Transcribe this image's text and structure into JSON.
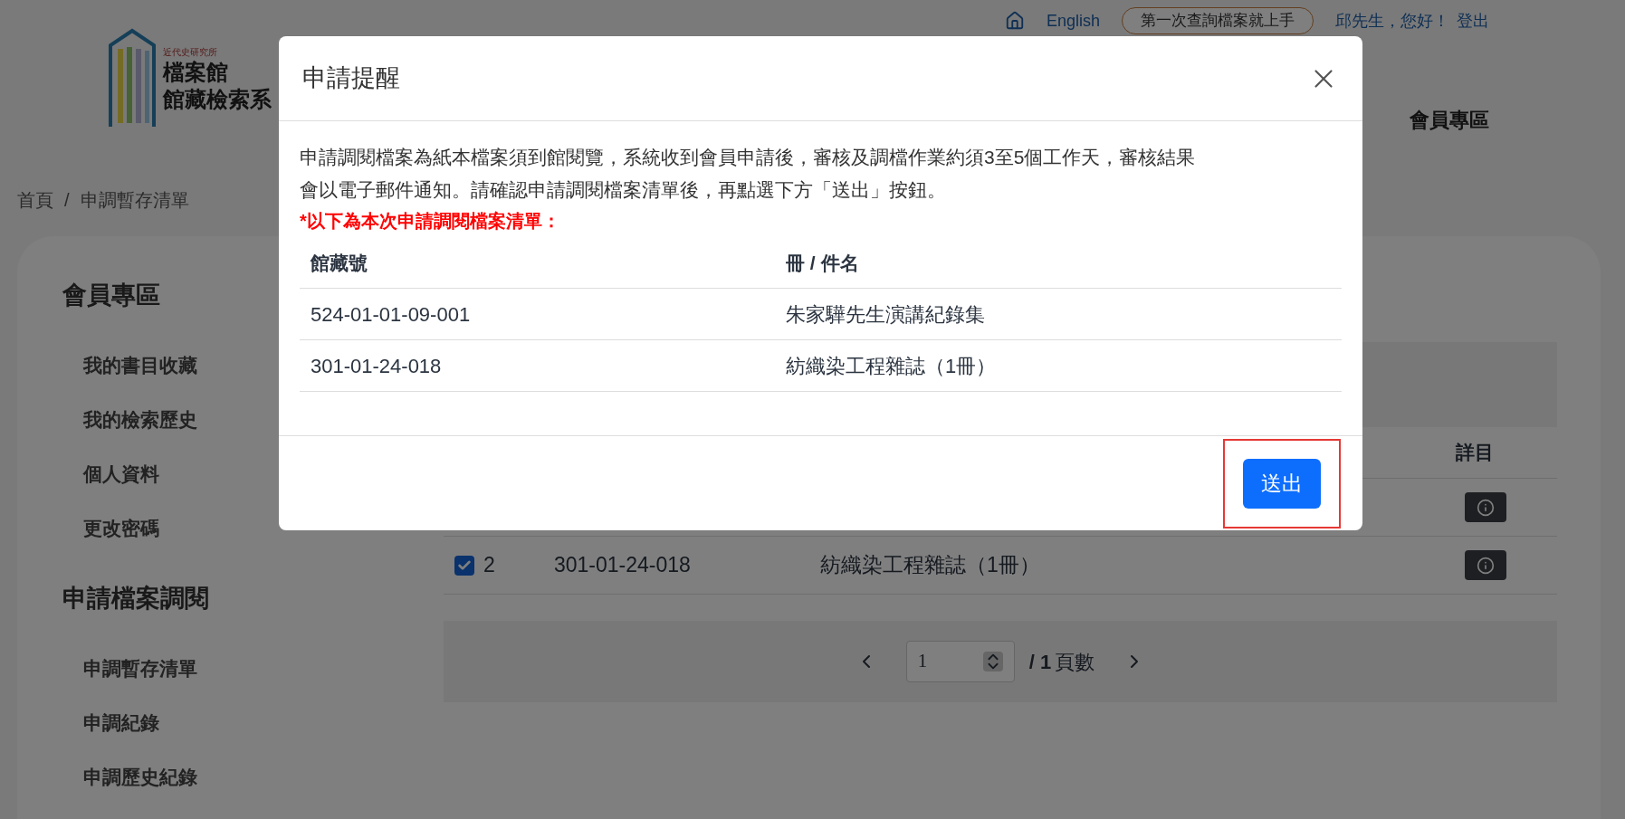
{
  "header": {
    "logo_org": "近代史研究所",
    "logo_line1": "檔案館",
    "logo_line2": "館藏檢索系",
    "language": "English",
    "guide_button": "第一次查詢檔案就上手",
    "greeting": "邱先生，您好！",
    "logout": "登出",
    "nav": [
      "會員專區"
    ]
  },
  "breadcrumb": {
    "items": [
      "首頁",
      "申調暫存清單"
    ],
    "separator": "/"
  },
  "sidebar": [
    {
      "title": "會員專區",
      "items": [
        "我的書目收藏",
        "我的檢索歷史",
        "個人資料",
        "更改密碼"
      ]
    },
    {
      "title": "申請檔案調閱",
      "items": [
        "申調暫存清單",
        "申調紀錄",
        "申調歷史紀錄"
      ]
    }
  ],
  "list": {
    "columns": [
      "詳目"
    ],
    "rows": [
      {
        "kind": "covered"
      },
      {
        "kind": "row",
        "checked": true,
        "index": "2",
        "number": "301-01-24-018",
        "title": "紡織染工程雜誌（1冊）"
      }
    ]
  },
  "pagination": {
    "page": "1",
    "total": "/ 1",
    "unit": "頁數"
  },
  "modal": {
    "title": "申請提醒",
    "message": "申請調閱檔案為紙本檔案須到館閱覽，系統收到會員申請後，審核及調檔作業約須3至5個工作天，審核結果會以電子郵件通知。請確認申請調閱檔案清單後，再點選下方「送出」按鈕。",
    "notice": "*以下為本次申請調閱檔案清單：",
    "columns": [
      "館藏號",
      "冊 / 件名"
    ],
    "rows": [
      [
        "524-01-01-09-001",
        "朱家驊先生演講紀錄集"
      ],
      [
        "301-01-24-018",
        "紡織染工程雜誌（1冊）"
      ]
    ],
    "submit": "送出",
    "submit_highlighted": true
  }
}
